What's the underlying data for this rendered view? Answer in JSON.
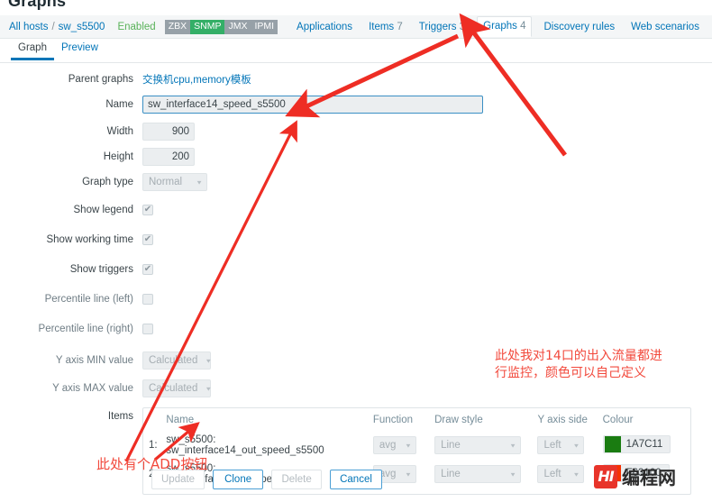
{
  "page": {
    "title": "Graphs"
  },
  "breadcrumb": {
    "all_hosts": "All hosts",
    "separator": "/",
    "host": "sw_s5500",
    "status": "Enabled",
    "interfaces": [
      {
        "label": "ZBX",
        "active": false
      },
      {
        "label": "SNMP",
        "active": true
      },
      {
        "label": "JMX",
        "active": false
      },
      {
        "label": "IPMI",
        "active": false
      }
    ],
    "nav": [
      {
        "label": "Applications",
        "count": "",
        "selected": false
      },
      {
        "label": "Items",
        "count": "7",
        "selected": false
      },
      {
        "label": "Triggers",
        "count": "3",
        "selected": false
      },
      {
        "label": "Graphs",
        "count": "4",
        "selected": true
      },
      {
        "label": "Discovery rules",
        "count": "",
        "selected": false
      },
      {
        "label": "Web scenarios",
        "count": "",
        "selected": false
      }
    ]
  },
  "tabs": [
    {
      "label": "Graph",
      "active": true
    },
    {
      "label": "Preview",
      "active": false
    }
  ],
  "form": {
    "parent_graphs": {
      "label": "Parent graphs",
      "value": "交换机cpu,memory模板"
    },
    "name": {
      "label": "Name",
      "value": "sw_interface14_speed_s5500",
      "placeholder": ""
    },
    "width": {
      "label": "Width",
      "value": "900"
    },
    "height": {
      "label": "Height",
      "value": "200"
    },
    "graph_type": {
      "label": "Graph type",
      "value": "Normal"
    },
    "show_legend": {
      "label": "Show legend",
      "checked": true
    },
    "show_working_time": {
      "label": "Show working time",
      "checked": true
    },
    "show_triggers": {
      "label": "Show triggers",
      "checked": true
    },
    "percentile_left": {
      "label": "Percentile line (left)",
      "checked": false
    },
    "percentile_right": {
      "label": "Percentile line (right)",
      "checked": false
    },
    "y_min": {
      "label": "Y axis MIN value",
      "value": "Calculated"
    },
    "y_max": {
      "label": "Y axis MAX value",
      "value": "Calculated"
    },
    "items": {
      "label": "Items"
    }
  },
  "items_table": {
    "headers": {
      "num": "",
      "name": "Name",
      "function": "Function",
      "draw_style": "Draw style",
      "y_axis_side": "Y axis side",
      "colour": "Colour"
    },
    "rows": [
      {
        "num": "1:",
        "name": "sw_s5500: sw_interface14_out_speed_s5500",
        "function": "avg",
        "draw_style": "Line",
        "y_axis_side": "Left",
        "colour_code": "1A7C11",
        "colour_hex": "#1A7C11"
      },
      {
        "num": "2:",
        "name": "sw_s5500: sw_interface14_in_speed_s5500",
        "function": "avg",
        "draw_style": "Line",
        "y_axis_side": "Left",
        "colour_code": "F63100",
        "colour_hex": "#F63100"
      }
    ]
  },
  "footer_buttons": [
    {
      "label": "Update",
      "disabled": true
    },
    {
      "label": "Clone",
      "disabled": false
    },
    {
      "label": "Delete",
      "disabled": true
    },
    {
      "label": "Cancel",
      "disabled": false
    }
  ],
  "annotations": {
    "accent_color": "#F2493C",
    "right_note": "此处我对14口的出入流量都进\n行监控，颜色可以自己定义",
    "bottom_note": "此处有个ADD按钮"
  },
  "watermark": {
    "badge": "HI",
    "text": "编程网"
  }
}
